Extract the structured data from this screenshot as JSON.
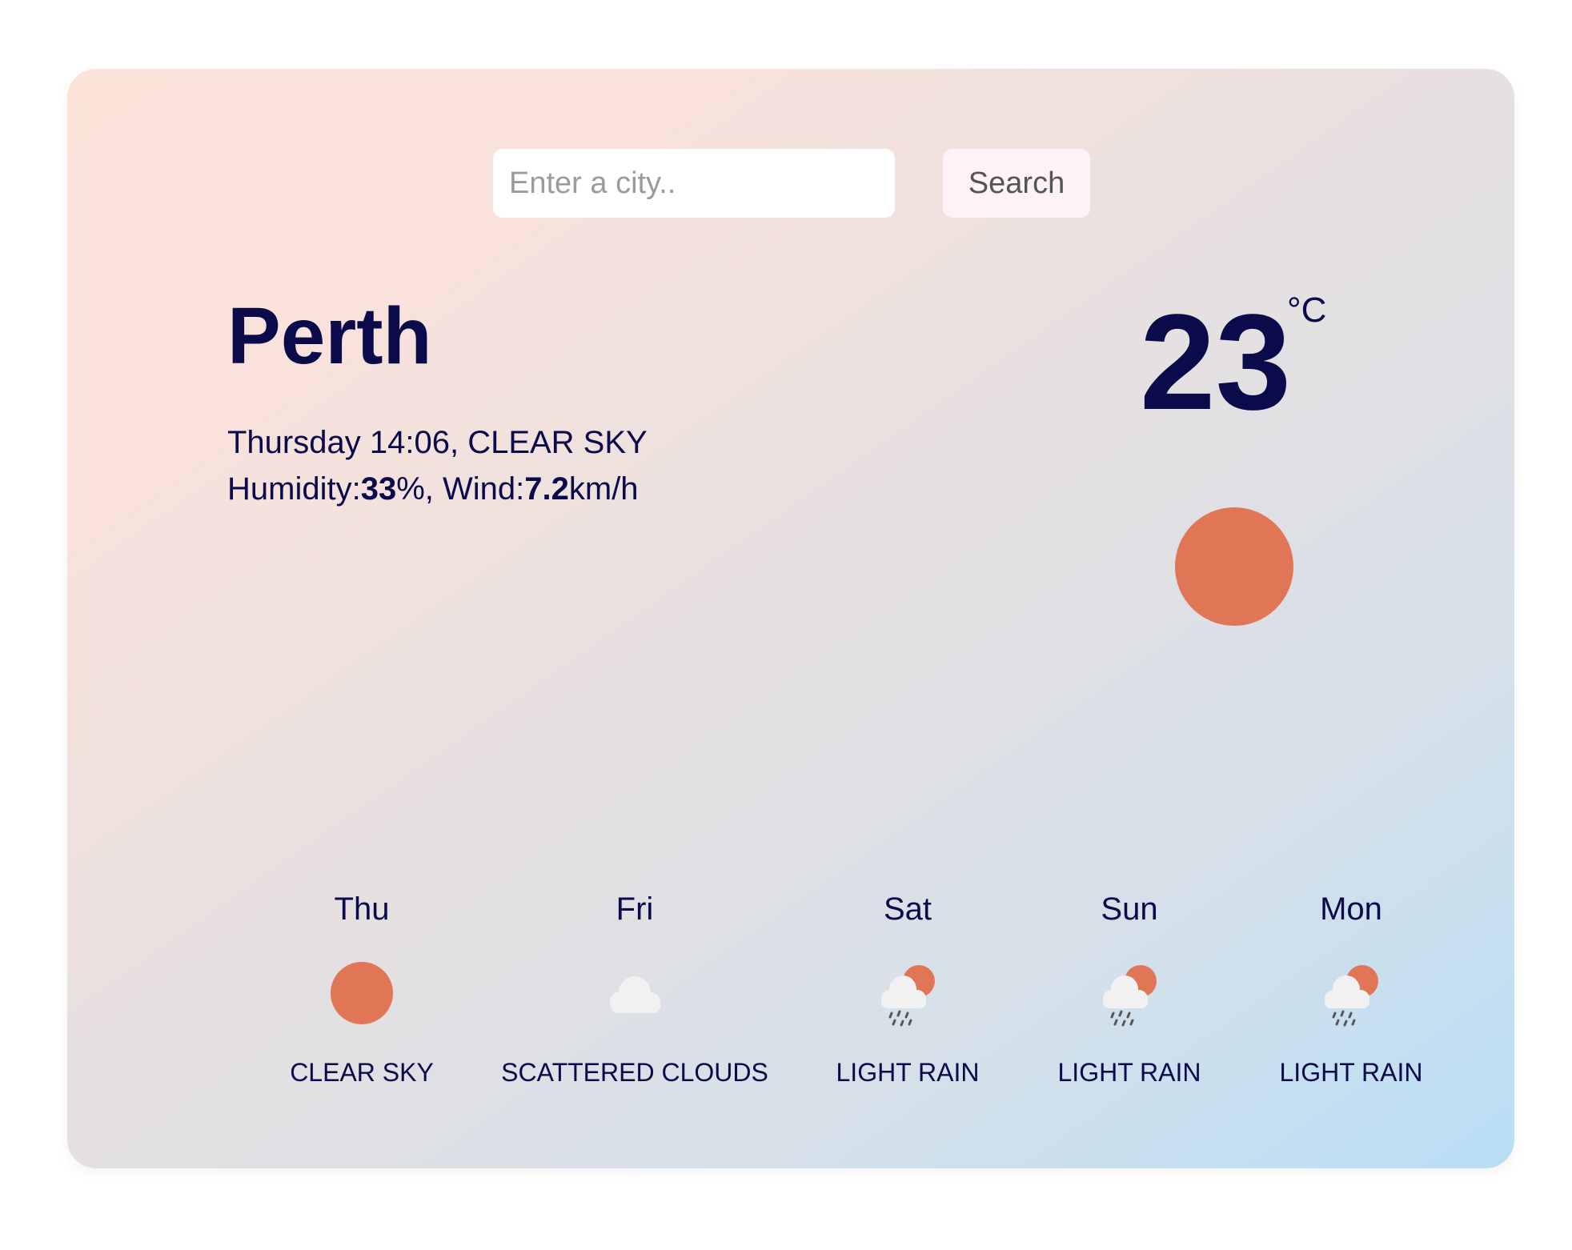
{
  "search": {
    "placeholder": "Enter a city..",
    "button_label": "Search"
  },
  "current": {
    "city": "Perth",
    "day_time": "Thursday 14:06",
    "condition": "CLEAR SKY",
    "humidity_label": "Humidity:",
    "humidity_value": "33",
    "humidity_unit": "%",
    "wind_label": "Wind:",
    "wind_value": "7.2",
    "wind_unit": "km/h",
    "temperature": "23",
    "unit": "°C",
    "icon": "sun-icon",
    "colors": {
      "sun": "#e07656",
      "text": "#0b0a4a"
    }
  },
  "forecast": [
    {
      "day": "Thu",
      "description": "CLEAR SKY",
      "icon": "sun-icon"
    },
    {
      "day": "Fri",
      "description": "SCATTERED CLOUDS",
      "icon": "cloud-icon"
    },
    {
      "day": "Sat",
      "description": "LIGHT RAIN",
      "icon": "rain-cloud-sun-icon"
    },
    {
      "day": "Sun",
      "description": "LIGHT RAIN",
      "icon": "rain-cloud-sun-icon"
    },
    {
      "day": "Mon",
      "description": "LIGHT RAIN",
      "icon": "rain-cloud-sun-icon"
    }
  ]
}
